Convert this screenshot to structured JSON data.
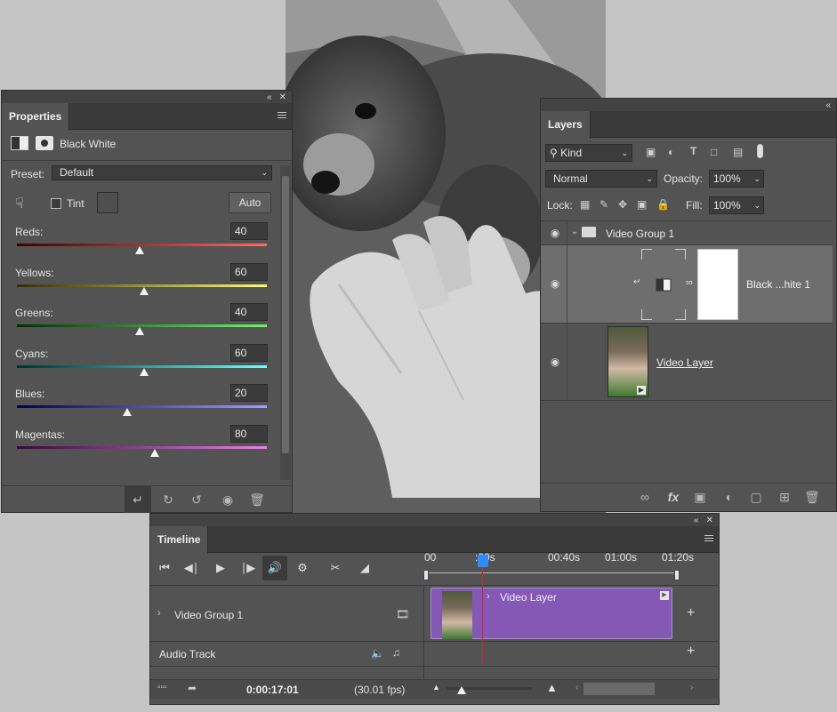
{
  "properties": {
    "tab": "Properties",
    "adjustment_name": "Black  White",
    "preset_label": "Preset:",
    "preset_value": "Default",
    "tint_label": "Tint",
    "auto_label": "Auto",
    "sliders": [
      {
        "label": "Reds:",
        "value": "40",
        "pos": 0.49,
        "from": "#400000",
        "to": "#ff6a6a"
      },
      {
        "label": "Yellows:",
        "value": "60",
        "pos": 0.51,
        "from": "#303000",
        "to": "#ffff60"
      },
      {
        "label": "Greens:",
        "value": "40",
        "pos": 0.49,
        "from": "#003000",
        "to": "#60ff60"
      },
      {
        "label": "Cyans:",
        "value": "60",
        "pos": 0.51,
        "from": "#003030",
        "to": "#70ffff"
      },
      {
        "label": "Blues:",
        "value": "20",
        "pos": 0.44,
        "from": "#000040",
        "to": "#a0a0ff"
      },
      {
        "label": "Magentas:",
        "value": "80",
        "pos": 0.55,
        "from": "#400040",
        "to": "#ff70ff"
      }
    ]
  },
  "layers": {
    "tab": "Layers",
    "filter_kind": "Kind",
    "blend_mode": "Normal",
    "opacity_label": "Opacity:",
    "opacity_value": "100%",
    "lock_label": "Lock:",
    "fill_label": "Fill:",
    "fill_value": "100%",
    "group_name": "Video Group 1",
    "adjustment_layer_name": "Black ...hite 1",
    "video_layer_name": "Video Layer"
  },
  "timeline": {
    "tab": "Timeline",
    "ruler_labels": [
      "00",
      ":20s",
      "00:40s",
      "01:00s",
      "01:20s"
    ],
    "track_group_name": "Video Group 1",
    "clip_name": "Video Layer",
    "audio_track_label": "Audio Track",
    "current_time": "0:00:17:01",
    "fps": "(30.01 fps)"
  },
  "colors": {
    "panel_bg": "#535353",
    "clip_purple": "#8458b4",
    "playhead_blue": "#2f8cff",
    "playhead_red": "#d22525"
  }
}
